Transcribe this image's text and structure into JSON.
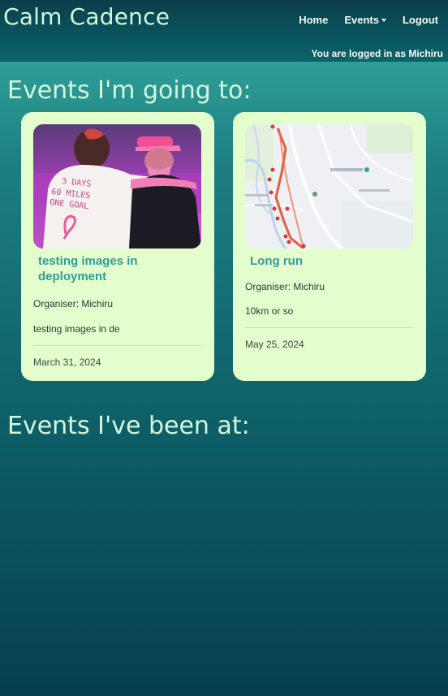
{
  "navbar": {
    "brand": "Calm Cadence",
    "links": {
      "home": "Home",
      "events": "Events",
      "logout": "Logout"
    },
    "logged_in_text": "You are logged in as Michiru"
  },
  "sections": {
    "going_title": "Events I'm going to:",
    "been_title": "Events I've been at:"
  },
  "events_going": [
    {
      "title": "testing images in deployment",
      "organiser": "Organiser: Michiru",
      "description": "testing images in de",
      "date": "March 31, 2024",
      "image": "photo-event-icon"
    },
    {
      "title": "Long run",
      "organiser": "Organiser: Michiru",
      "description": "10km or so",
      "date": "May 25, 2024",
      "image": "map-route-icon"
    }
  ],
  "colors": {
    "accent": "#2f9e98",
    "card_bg": "#e4fdcd",
    "heading": "#d4f7dc"
  }
}
